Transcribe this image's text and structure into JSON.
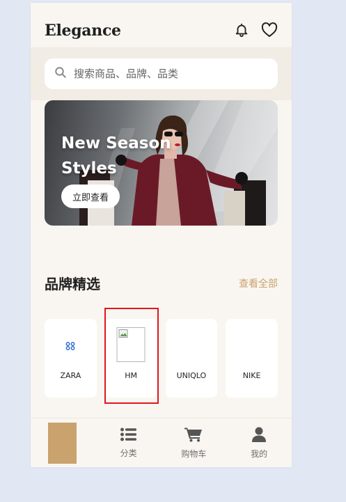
{
  "app": {
    "logo": "Elegance"
  },
  "header": {
    "icons": [
      "bell-icon",
      "heart-icon"
    ]
  },
  "search": {
    "placeholder": "搜索商品、品牌、品类"
  },
  "banner": {
    "title": "New Season Styles",
    "button_label": "立即查看"
  },
  "brands_section": {
    "title": "品牌精选",
    "link_label": "查看全部",
    "items": [
      {
        "name": "ZARA",
        "logo": "broken-image-glyph"
      },
      {
        "name": "HM",
        "logo": "broken-image-placeholder"
      },
      {
        "name": "UNIQLO",
        "logo": "none"
      },
      {
        "name": "NIKE",
        "logo": "none"
      }
    ]
  },
  "bottom_nav": {
    "items": [
      {
        "label": "",
        "icon": "home-block",
        "active": true
      },
      {
        "label": "分类",
        "icon": "list-icon"
      },
      {
        "label": "购物车",
        "icon": "cart-icon"
      },
      {
        "label": "我的",
        "icon": "user-icon"
      }
    ]
  },
  "colors": {
    "accent": "#c9a26e",
    "background": "#f9f6f1",
    "highlight": "#e0161b"
  }
}
